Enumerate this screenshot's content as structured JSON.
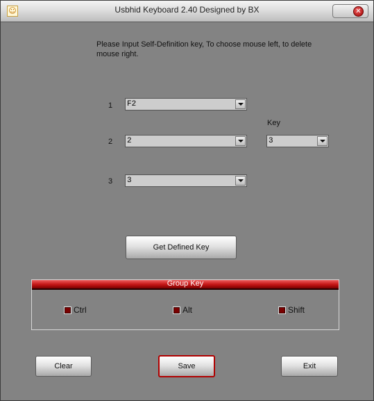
{
  "window": {
    "title": "Usbhid Keyboard 2.40 Designed by BX",
    "close_glyph": "✕",
    "icon_glyph": "☺"
  },
  "instruction": "Please Input Self-Definition key, To choose mouse left, to delete mouse right.",
  "rows": [
    {
      "number": "1",
      "value": "F2"
    },
    {
      "number": "2",
      "value": "2"
    },
    {
      "number": "3",
      "value": "3"
    }
  ],
  "key_column": {
    "label": "Key",
    "value": "3"
  },
  "buttons": {
    "get_defined_key": "Get Defined Key",
    "clear": "Clear",
    "save": "Save",
    "exit": "Exit"
  },
  "group_key": {
    "title": "Group Key",
    "options": [
      {
        "label": "Ctrl",
        "checked": false
      },
      {
        "label": "Alt",
        "checked": false
      },
      {
        "label": "Shift",
        "checked": false
      }
    ]
  },
  "colors": {
    "accent_red": "#c21414",
    "background": "#838383"
  },
  "icons": {
    "app": "app-icon",
    "close": "close-icon",
    "dropdown": "chevron-down-icon"
  }
}
